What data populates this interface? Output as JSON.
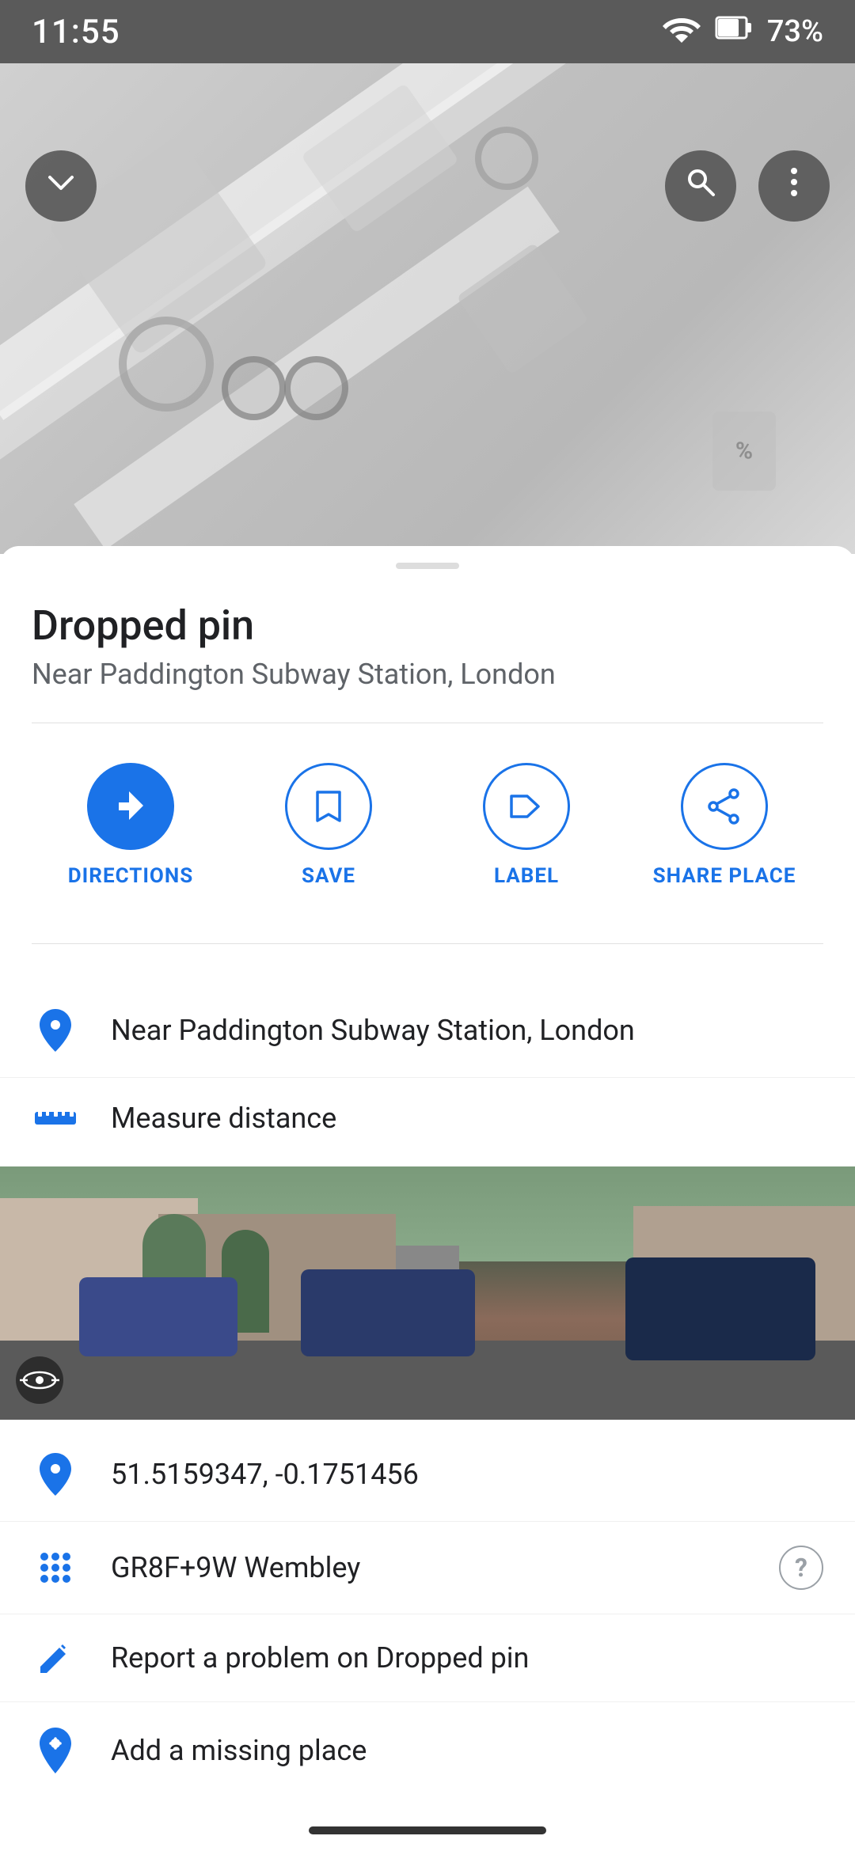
{
  "status_bar": {
    "time": "11:55",
    "battery": "73%",
    "wifi_icon": "wifi",
    "battery_icon": "battery"
  },
  "map": {
    "collapse_button_label": "collapse",
    "search_button_label": "search",
    "more_button_label": "more options"
  },
  "place": {
    "title": "Dropped pin",
    "subtitle": "Near Paddington Subway Station, London"
  },
  "actions": [
    {
      "id": "directions",
      "label": "DIRECTIONS",
      "icon": "directions-arrow",
      "filled": true
    },
    {
      "id": "save",
      "label": "SAVE",
      "icon": "bookmark",
      "filled": false
    },
    {
      "id": "label",
      "label": "LABEL",
      "icon": "flag",
      "filled": false
    },
    {
      "id": "share",
      "label": "SHARE PLACE",
      "icon": "share",
      "filled": false
    }
  ],
  "info_rows": [
    {
      "id": "location",
      "icon": "location-pin",
      "text": "Near Paddington Subway Station, London",
      "has_help": false
    },
    {
      "id": "measure",
      "icon": "measure-ruler",
      "text": "Measure distance",
      "has_help": false
    }
  ],
  "street_view": {
    "label": "Street View"
  },
  "detail_rows": [
    {
      "id": "coordinates",
      "icon": "location-pin",
      "text": "51.5159347, -0.1751456",
      "has_help": false
    },
    {
      "id": "plus-code",
      "icon": "grid-dots",
      "text": "GR8F+9W Wembley",
      "has_help": true,
      "help_label": "?"
    },
    {
      "id": "report",
      "icon": "pencil-edit",
      "text": "Report a problem on Dropped pin",
      "has_help": false
    },
    {
      "id": "missing-place",
      "icon": "location-plus",
      "text": "Add a missing place",
      "has_help": false
    }
  ],
  "bottom_nav": {
    "home_indicator": "home indicator"
  }
}
